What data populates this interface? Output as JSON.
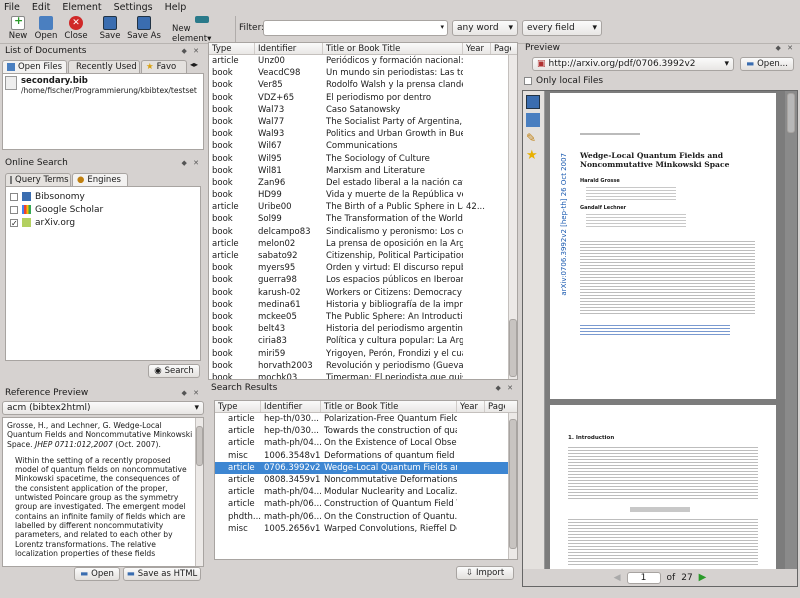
{
  "menu": [
    "File",
    "Edit",
    "Element",
    "Settings",
    "Help"
  ],
  "toolbar": {
    "new": "New",
    "open": "Open",
    "close": "Close",
    "save": "Save",
    "save_as": "Save As",
    "new_element": "New element"
  },
  "filter": {
    "label": "Filter:",
    "value": "",
    "mode": "any word",
    "field": "every field"
  },
  "documents": {
    "title": "List of Documents",
    "tabs": [
      "Open Files",
      "Recently Used",
      "Favo"
    ],
    "file_name": "secondary.bib",
    "file_path": "/home/fischer/Programmierung/kbibtex/testset"
  },
  "online_search": {
    "title": "Online Search",
    "tabs": [
      "Query Terms",
      "Engines"
    ],
    "engines": [
      {
        "name": "Bibsonomy",
        "checked": false
      },
      {
        "name": "Google Scholar",
        "checked": false
      },
      {
        "name": "arXiv.org",
        "checked": true
      }
    ],
    "search_label": "Search"
  },
  "reference_preview": {
    "title": "Reference Preview",
    "style": "acm (bibtex2html)",
    "citation": "Grosse, H., and Lechner, G. Wedge-Local Quantum Fields and Noncommutative Minkowski Space.",
    "journal": "JHEP 0711:012,2007",
    "date": "(Oct. 2007).",
    "abstract": "Within the setting of a recently proposed model of quantum fields on noncommutative Minkowski spacetime, the consequences of the consistent application of the proper, untwisted Poincare group as the symmetry group are investigated. The emergent model contains an infinite family of fields which are labelled by different noncommutativity parameters, and related to each other by Lorentz transformations. The relative localization properties of these fields",
    "open_label": "Open",
    "save_html_label": "Save as HTML"
  },
  "main_table": {
    "columns": [
      "Type",
      "Identifier",
      "Title or Book Title",
      "Year",
      "Page"
    ],
    "rows": [
      [
        "article",
        "Unz00",
        "Periódicos y formación nacional: B...",
        "",
        ""
      ],
      [
        "book",
        "VeacdC98",
        "Un mundo sin periodistas: Las tort...",
        "",
        ""
      ],
      [
        "book",
        "Ver85",
        "Rodolfo Walsh y la prensa clandes...",
        "",
        ""
      ],
      [
        "book",
        "VDZ+65",
        "El periodismo por dentro",
        "",
        ""
      ],
      [
        "book",
        "Wal73",
        "Caso Satanowsky",
        "",
        ""
      ],
      [
        "book",
        "Wal77",
        "The Socialist Party of Argentina, 1...",
        "",
        ""
      ],
      [
        "book",
        "Wal93",
        "Politics and Urban Growth in Buen...",
        "",
        ""
      ],
      [
        "book",
        "Wil67",
        "Communications",
        "",
        ""
      ],
      [
        "book",
        "Wil95",
        "The Sociology of Culture",
        "",
        ""
      ],
      [
        "book",
        "Wil81",
        "Marxism and Literature",
        "",
        ""
      ],
      [
        "book",
        "Zan96",
        "Del estado liberal a la nación cató...",
        "",
        ""
      ],
      [
        "book",
        "HD99",
        "Vida y muerte de la República ver...",
        "",
        ""
      ],
      [
        "article",
        "Uribe00",
        "The Birth of a Public Sphere in Lati...",
        "",
        ""
      ],
      [
        "book",
        "Sol99",
        "The Transformation of the World E...",
        "",
        ""
      ],
      [
        "book",
        "delcampo83",
        "Sindicalismo y peronismo: Los com...",
        "",
        ""
      ],
      [
        "article",
        "melon02",
        "La prensa de oposición en la Arge...",
        "",
        ""
      ],
      [
        "article",
        "sabato92",
        "Citizenship, Political Participation ...",
        "",
        ""
      ],
      [
        "book",
        "myers95",
        "Orden y virtud: El discurso republi...",
        "",
        ""
      ],
      [
        "book",
        "guerra98",
        "Los espacios públicos en Iberoam...",
        "",
        ""
      ],
      [
        "book",
        "karush-02",
        "Workers or Citizens: Democracy a...",
        "",
        ""
      ],
      [
        "book",
        "medina61",
        "Historia y bibliografía de la impren...",
        "",
        ""
      ],
      [
        "book",
        "mckee05",
        "The Public Sphere: An Introduction",
        "",
        ""
      ],
      [
        "book",
        "belt43",
        "Historia del periodismo argentino",
        "",
        ""
      ],
      [
        "book",
        "ciria83",
        "Política y cultura popular: La Arge...",
        "",
        ""
      ],
      [
        "book",
        "miri59",
        "Yrigoyen, Perón, Frondizi y el cuar...",
        "",
        ""
      ],
      [
        "book",
        "horvath2003",
        "Revolución y periodismo (Guevara...",
        "",
        ""
      ],
      [
        "book",
        "mochk03",
        "Timerman: El periodista que quiso ...",
        "",
        ""
      ],
      [
        "book",
        "distef04",
        "El púlpito y la plaza: Clero, socied...",
        "",
        ""
      ],
      [
        "book",
        "bianchi04",
        "Historia de las religiones en la Arg...",
        "",
        ""
      ],
      [
        "book",
        "SC12",
        "La prensa argentina: Antecedent...",
        "",
        ""
      ],
      [
        "incolle...",
        "tulio95",
        "The Colonial VemphLetrado as a R...",
        "",
        ""
      ],
      [
        "article",
        "0706.3992v2",
        "Wedge-Local Quantum Fields and ...",
        "",
        ""
      ]
    ],
    "selected": 31,
    "row_year_12": "42..."
  },
  "search_results": {
    "title": "Search Results",
    "columns": [
      "Type",
      "Identifier",
      "Title or Book Title",
      "Year",
      "Page"
    ],
    "rows": [
      [
        "article",
        "hep-th/030...",
        "Polarization-Free Quantum Field..."
      ],
      [
        "article",
        "hep-th/030...",
        "Towards the construction of quant..."
      ],
      [
        "article",
        "math-ph/04...",
        "On the Existence of Local Obser..."
      ],
      [
        "misc",
        "1006.3548v1",
        "Deformations of quantum field t..."
      ],
      [
        "article",
        "0706.3992v2",
        "Wedge-Local Quantum Fields an..."
      ],
      [
        "article",
        "0808.3459v1",
        "Noncommutative Deformations ..."
      ],
      [
        "article",
        "math-ph/04...",
        "Modular Nuclearity and Localiz..."
      ],
      [
        "article",
        "math-ph/06...",
        "Construction of Quantum Field T..."
      ],
      [
        "phdth...",
        "math-ph/06...",
        "On the Construction of Quantu..."
      ],
      [
        "misc",
        "1005.2656v1",
        "Warped Convolutions, Rieffel De..."
      ]
    ],
    "selected": 4,
    "import_label": "Import"
  },
  "preview": {
    "title": "Preview",
    "url": "http://arxiv.org/pdf/0706.3992v2",
    "open_label": "Open...",
    "only_local": "Only local Files",
    "page": "1",
    "of": "of",
    "total": "27",
    "paper_title": "Wedge-Local Quantum Fields and Noncommutative Minkowski Space",
    "authors": [
      "Harald Grosse",
      "Gandalf Lechner"
    ],
    "side_stamp": "arXiv:0706.3992v2 [hep-th] 26 Oct 2007",
    "section": "1. Introduction"
  }
}
